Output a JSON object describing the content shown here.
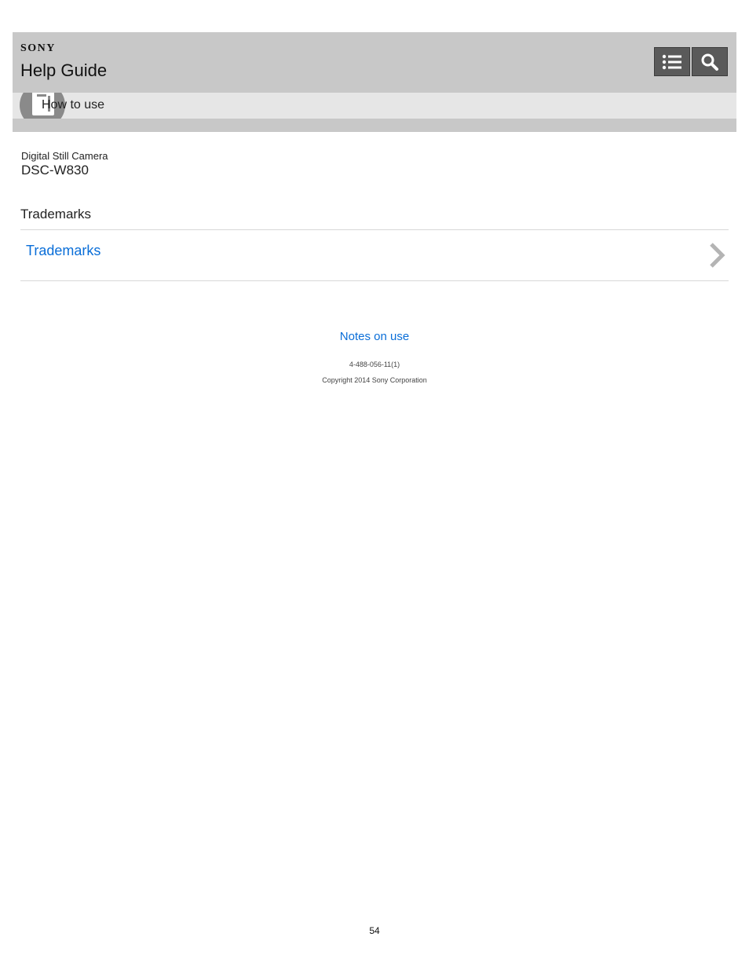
{
  "header": {
    "brand": "SONY",
    "title": "Help Guide",
    "buttons": {
      "list_icon": "list-icon",
      "search_icon": "search-icon"
    },
    "background_color": "#c8c8c8",
    "button_color": "#5a5a5a"
  },
  "subnav": {
    "label": "How to use",
    "icon": "camera-icon"
  },
  "product": {
    "kind": "Digital Still Camera",
    "model": "DSC-W830"
  },
  "section": {
    "title": "Trademarks",
    "items": [
      {
        "label": "Trademarks",
        "icon": "chevron-right-icon"
      }
    ]
  },
  "footer": {
    "notes_link": "Notes on use",
    "doc_code": "4-488-056-11(1)",
    "copyright": "Copyright 2014 Sony Corporation"
  },
  "page_number": "54",
  "colors": {
    "link": "#0a6ed8",
    "divider": "#d8d8d8"
  }
}
